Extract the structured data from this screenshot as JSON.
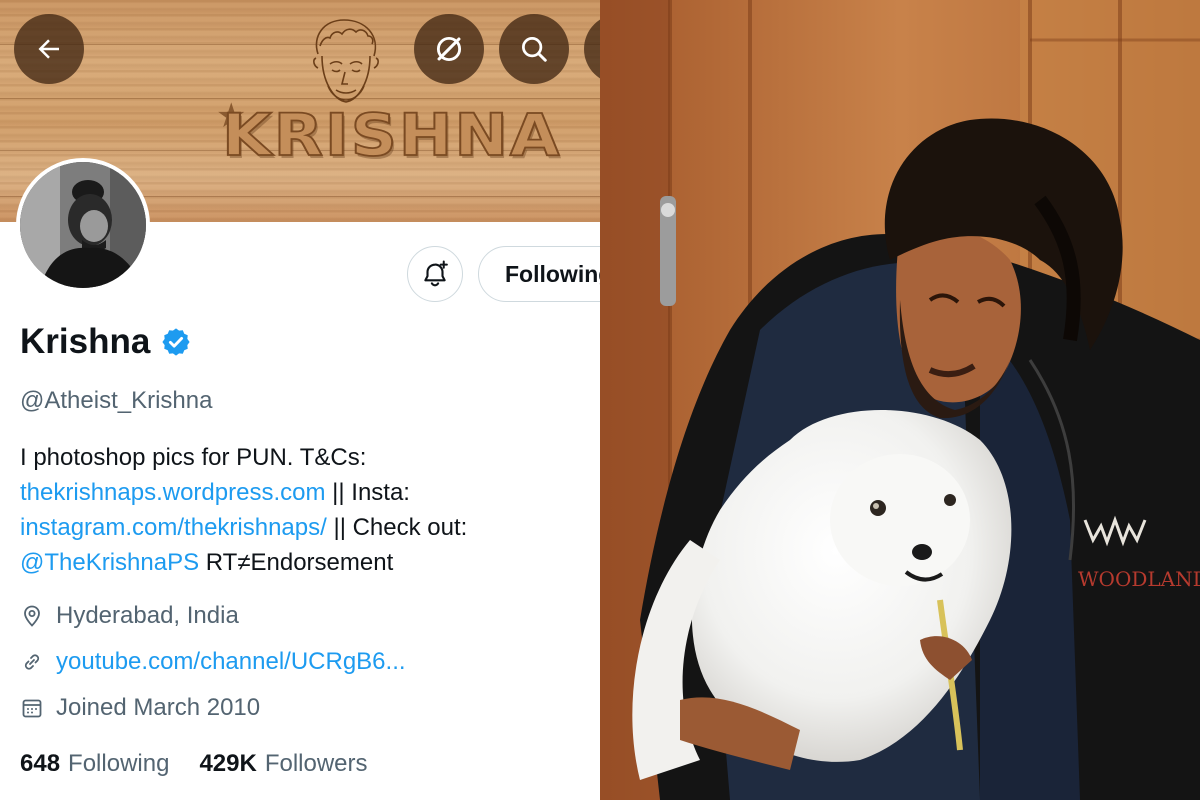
{
  "banner": {
    "logo_text": "KRISHNA"
  },
  "profile": {
    "name": "Krishna",
    "handle": "@Atheist_Krishna",
    "bio_line1": "I photoshop pics for PUN. T&Cs:",
    "bio_link1": "thekrishnaps.wordpress.com",
    "bio_sep1": " || Insta:",
    "bio_link2": "instagram.com/thekrishnaps/",
    "bio_sep2": " || Check out:",
    "bio_mention": "@TheKrishnaPS",
    "bio_end": " RT≠Endorsement",
    "location": "Hyderabad, India",
    "website": "youtube.com/channel/UCRgB6...",
    "joined": "Joined March 2010",
    "following_count": "648",
    "following_label": "Following",
    "followers_count": "429K",
    "followers_label": "Followers"
  },
  "actions": {
    "following_button": "Following"
  },
  "photo": {
    "shirt_text": "WOODLAND"
  },
  "icons": {
    "back": "arrow-left-icon",
    "grok": "grok-icon",
    "search": "search-icon",
    "bell": "bell-plus-icon",
    "verified": "verified-badge-icon",
    "location": "location-pin-icon",
    "link": "link-icon",
    "calendar": "calendar-icon"
  },
  "colors": {
    "accent": "#1d9bf0",
    "text": "#0f1419",
    "secondary": "#536471"
  }
}
